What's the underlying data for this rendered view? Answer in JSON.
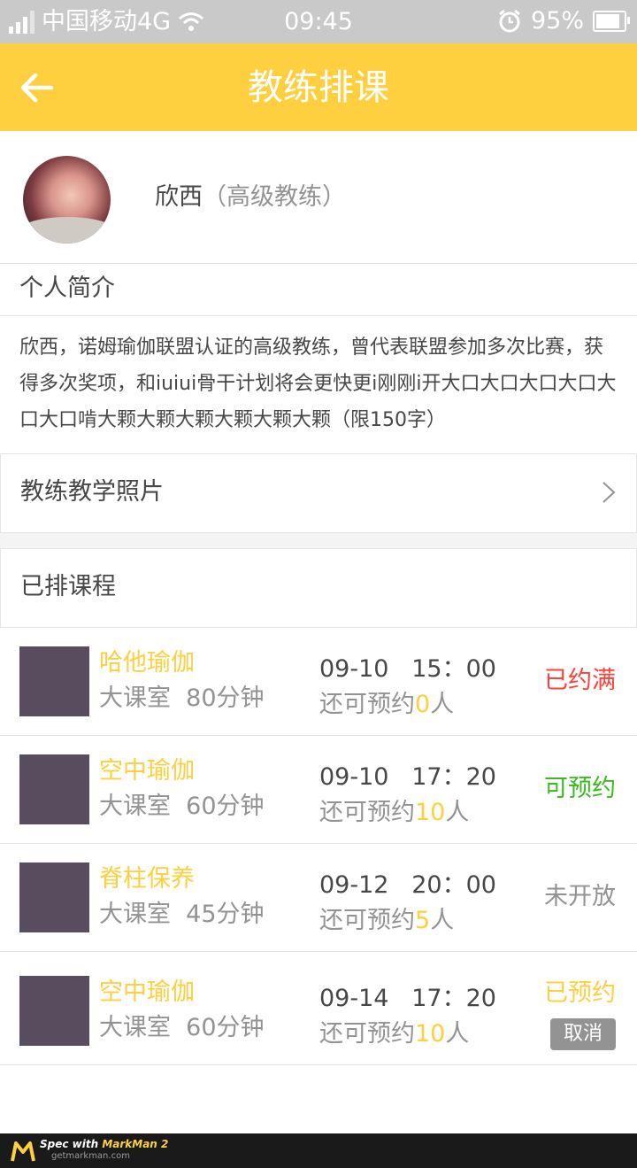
{
  "status_bar": {
    "carrier": "中国移动4G",
    "time": "09:45",
    "battery": "95%",
    "icons": [
      "signal-icon",
      "wifi-icon",
      "alarm-icon",
      "battery-icon"
    ]
  },
  "header": {
    "title": "教练排课",
    "back_icon": "back-arrow-icon"
  },
  "coach": {
    "name": "欣西",
    "level": "（高级教练）"
  },
  "intro": {
    "title": "个人简介",
    "text": "欣西，诺姆瑜伽联盟认证的高级教练，曾代表联盟参加多次比赛，获得多次奖项，和iuiui骨干计划将会更快更i刚刚i开大口大口大口大口大口大口啃大颗大颗大颗大颗大颗大颗（限150字）"
  },
  "photos": {
    "label": "教练教学照片",
    "icon": "chevron-right-icon"
  },
  "schedule": {
    "title": "已排课程",
    "courses": [
      {
        "name": "哈他瑜伽",
        "room": "大课室",
        "duration": "80分钟",
        "date": "09-10",
        "time": "15：00",
        "left_prefix": "还可预约",
        "left_count": "0",
        "left_suffix": "人",
        "status": "已约满",
        "status_color": "#ff4138",
        "cancel": ""
      },
      {
        "name": "空中瑜伽",
        "room": "大课室",
        "duration": "60分钟",
        "date": "09-10",
        "time": "17：20",
        "left_prefix": "还可预约",
        "left_count": "10",
        "left_suffix": "人",
        "status": "可预约",
        "status_color": "#37bc1d",
        "cancel": ""
      },
      {
        "name": "脊柱保养",
        "room": "大课室",
        "duration": "45分钟",
        "date": "09-12",
        "time": "20：00",
        "left_prefix": "还可预约",
        "left_count": "5",
        "left_suffix": "人",
        "status": "未开放",
        "status_color": "#939393",
        "cancel": ""
      },
      {
        "name": "空中瑜伽",
        "room": "大课室",
        "duration": "60分钟",
        "date": "09-14",
        "time": "17：20",
        "left_prefix": "还可预约",
        "left_count": "10",
        "left_suffix": "人",
        "status": "已预约",
        "status_color": "#fecf3f",
        "cancel": "取消"
      }
    ]
  },
  "colors": {
    "accent": "#fecf3f",
    "text_primary": "#474747",
    "text_secondary": "#939393",
    "full": "#ff4138",
    "available": "#37bc1d"
  },
  "footer": {
    "spec_prefix": "Spec with",
    "brand": "MarkMan 2",
    "site": "getmarkman.com"
  }
}
